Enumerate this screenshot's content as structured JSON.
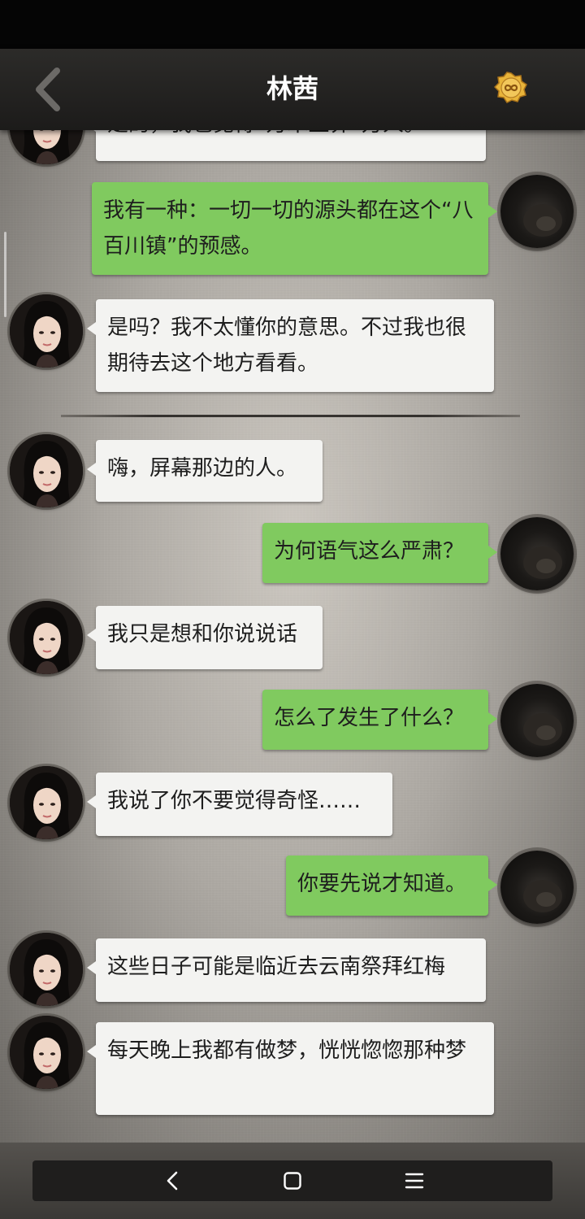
{
  "header": {
    "title": "林茜",
    "back_icon": "chevron-left-icon",
    "badge_icon": "infinity-coin-icon",
    "badge_color": "#e0a52a"
  },
  "colors": {
    "incoming_bubble": "#f3f3f1",
    "outgoing_bubble": "#80ca5f",
    "header_bg": "#242322"
  },
  "messages": [
    {
      "from": "linqian",
      "text": "是的，我也觉得“万木上界”万人。"
    },
    {
      "from": "me",
      "text": "我有一种：一切一切的源头都在这个“八百川镇”的预感。"
    },
    {
      "from": "linqian",
      "text": "是吗？我不太懂你的意思。不过我也很期待去这个地方看看。"
    },
    {
      "from": "linqian",
      "text": "嗨，屏幕那边的人。"
    },
    {
      "from": "me",
      "text": "为何语气这么严肃？"
    },
    {
      "from": "linqian",
      "text": "我只是想和你说说话"
    },
    {
      "from": "me",
      "text": "怎么了发生了什么？"
    },
    {
      "from": "linqian",
      "text": "我说了你不要觉得奇怪……"
    },
    {
      "from": "me",
      "text": "你要先说才知道。"
    },
    {
      "from": "linqian",
      "text": "这些日子可能是临近去云南祭拜红梅"
    },
    {
      "from": "linqian",
      "text": "每天晚上我都有做梦，恍恍惚惚那种梦"
    }
  ],
  "nav": {
    "back_icon": "nav-back-icon",
    "home_icon": "nav-home-icon",
    "menu_icon": "nav-menu-icon"
  }
}
